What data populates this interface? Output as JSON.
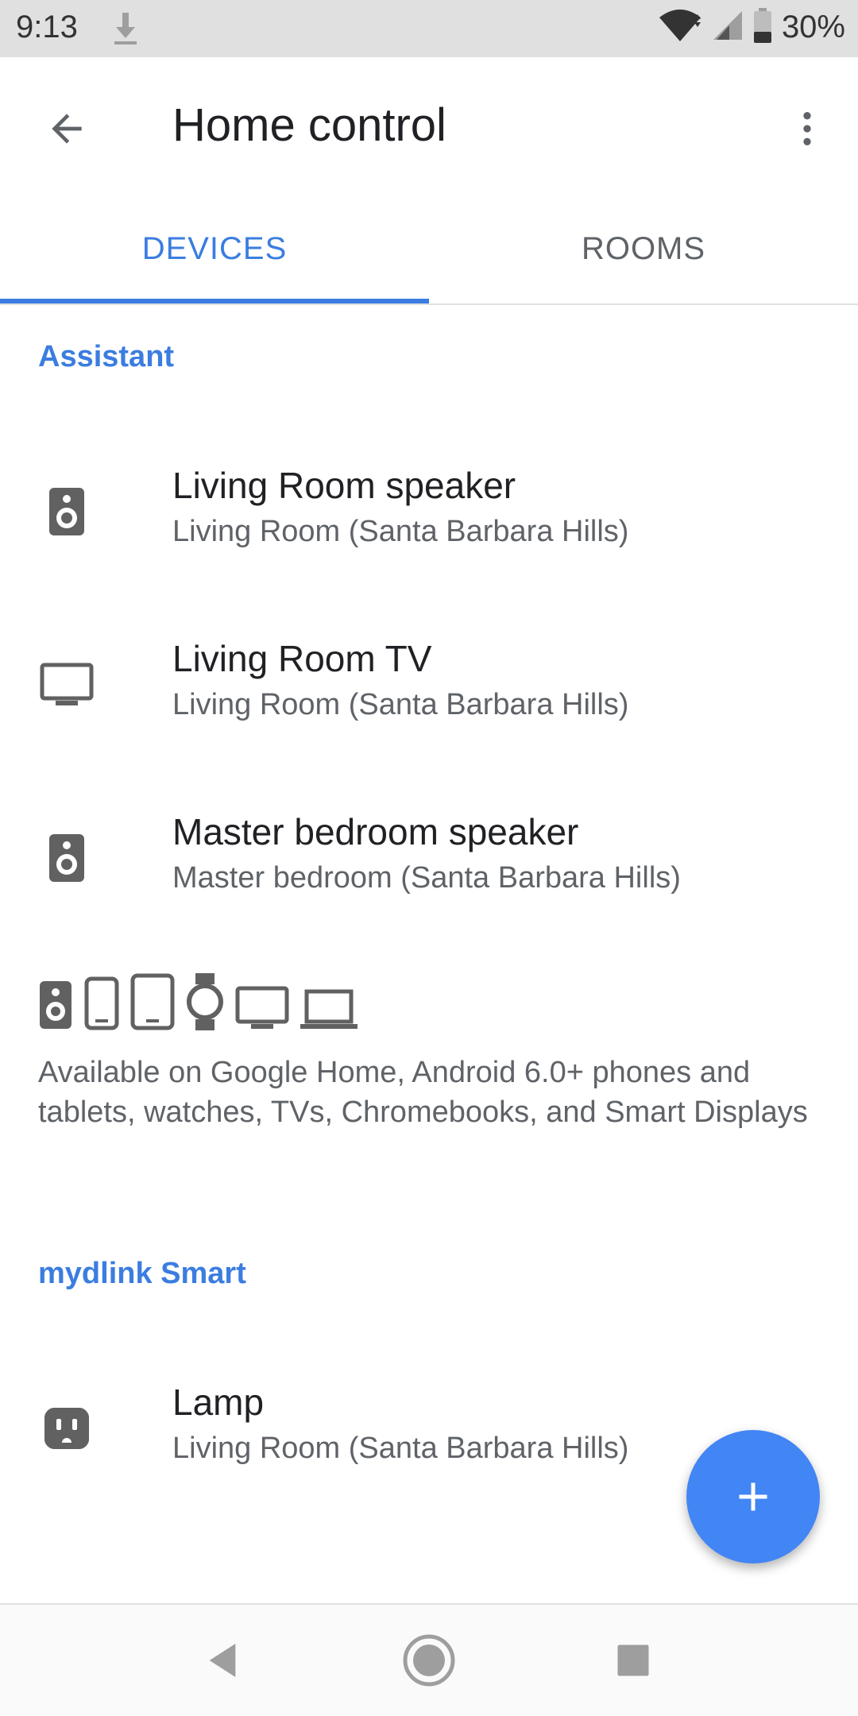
{
  "status": {
    "time": "9:13",
    "battery": "30%"
  },
  "app_bar": {
    "title": "Home control"
  },
  "tabs": [
    {
      "label": "DEVICES",
      "selected": true
    },
    {
      "label": "ROOMS",
      "selected": false
    }
  ],
  "sections": {
    "assistant": {
      "header": "Assistant",
      "devices": [
        {
          "name": "Living Room speaker",
          "location": "Living Room (Santa Barbara Hills)",
          "icon": "speaker-icon"
        },
        {
          "name": "Living Room TV",
          "location": "Living Room (Santa Barbara Hills)",
          "icon": "tv-icon"
        },
        {
          "name": "Master bedroom speaker",
          "location": "Master bedroom (Santa Barbara Hills)",
          "icon": "speaker-icon"
        }
      ],
      "availability": "Available on Google Home, Android 6.0+ phones and tablets, watches, TVs, Chromebooks, and Smart Displays"
    },
    "mydlink": {
      "header": "mydlink Smart",
      "devices": [
        {
          "name": "Lamp",
          "location": "Living Room (Santa Barbara Hills)",
          "icon": "outlet-icon"
        }
      ]
    }
  },
  "colors": {
    "accent": "#3b7de0",
    "fab": "#4285f4",
    "icon_gray": "#616161"
  }
}
